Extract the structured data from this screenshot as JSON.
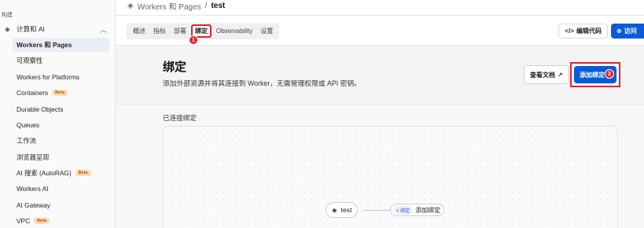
{
  "sidebar": {
    "section": "构建",
    "group": {
      "label": "计算和 AI"
    },
    "items": [
      {
        "label": "Workers 和 Pages",
        "active": true
      },
      {
        "label": "可观察性"
      },
      {
        "label": "Workers for Platforms"
      },
      {
        "label": "Containers",
        "badge": "Beta"
      },
      {
        "label": "Durable Objects"
      },
      {
        "label": "Queues"
      },
      {
        "label": "工作流"
      },
      {
        "label": "浏览器呈现"
      },
      {
        "label": "AI 搜索 (AutoRAG)",
        "badge": "Beta"
      },
      {
        "label": "Workers AI"
      },
      {
        "label": "AI Gateway"
      },
      {
        "label": "VPC",
        "badge": "Beta"
      }
    ]
  },
  "breadcrumb": {
    "parent": "Workers 和 Pages",
    "sep": "/",
    "current": "test"
  },
  "tabs": [
    "概述",
    "指标",
    "部署",
    "绑定",
    "Observability",
    "设置"
  ],
  "markers": {
    "one": "1",
    "two": "2"
  },
  "header_actions": {
    "code": "编辑代码",
    "visit": "访问"
  },
  "hero": {
    "title": "绑定",
    "subtitle": "添加外部资源并将其连接到 Worker，无需管理权限或 API 密钥。",
    "docs_label": "查看文档",
    "add_label": "添加绑定"
  },
  "connected": {
    "label": "已连接绑定",
    "worker_name": "test",
    "pill_tag": "绑定",
    "pill_label": "添加绑定"
  },
  "colors": {
    "accent": "#0a5bd8",
    "highlight": "#e2252b"
  }
}
